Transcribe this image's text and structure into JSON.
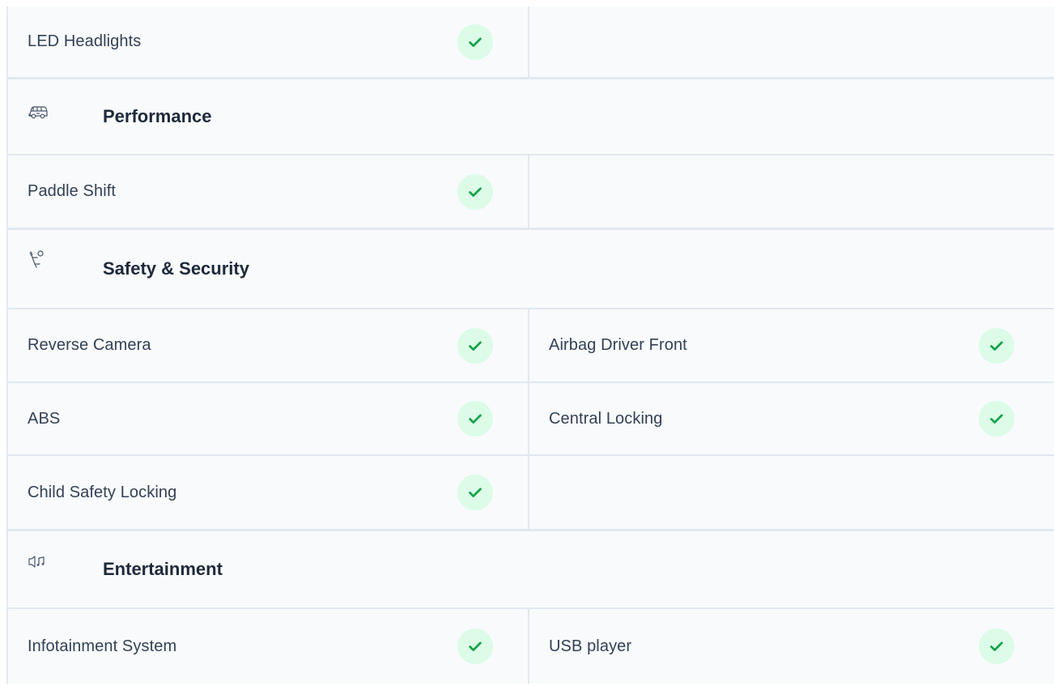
{
  "sections": [
    {
      "rows": [
        {
          "left": {
            "label": "LED Headlights",
            "available": true
          },
          "right": null
        }
      ]
    },
    {
      "title": "Performance",
      "icon": "car-icon",
      "rows": [
        {
          "left": {
            "label": "Paddle Shift",
            "available": true
          },
          "right": null
        }
      ]
    },
    {
      "title": "Safety & Security",
      "icon": "seatbelt-icon",
      "rows": [
        {
          "left": {
            "label": "Reverse Camera",
            "available": true
          },
          "right": {
            "label": "Airbag Driver Front",
            "available": true
          }
        },
        {
          "left": {
            "label": "ABS",
            "available": true
          },
          "right": {
            "label": "Central Locking",
            "available": true
          }
        },
        {
          "left": {
            "label": "Child Safety Locking",
            "available": true
          },
          "right": null
        }
      ]
    },
    {
      "title": "Entertainment",
      "icon": "speaker-music-icon",
      "rows": [
        {
          "left": {
            "label": "Infotainment System",
            "available": true
          },
          "right": {
            "label": "USB player",
            "available": true
          }
        }
      ]
    }
  ],
  "colors": {
    "check_bg": "#dcfce7",
    "check_mark": "#16a34a",
    "border": "#e2e8f0",
    "text": "#334155",
    "heading": "#1e293b"
  }
}
